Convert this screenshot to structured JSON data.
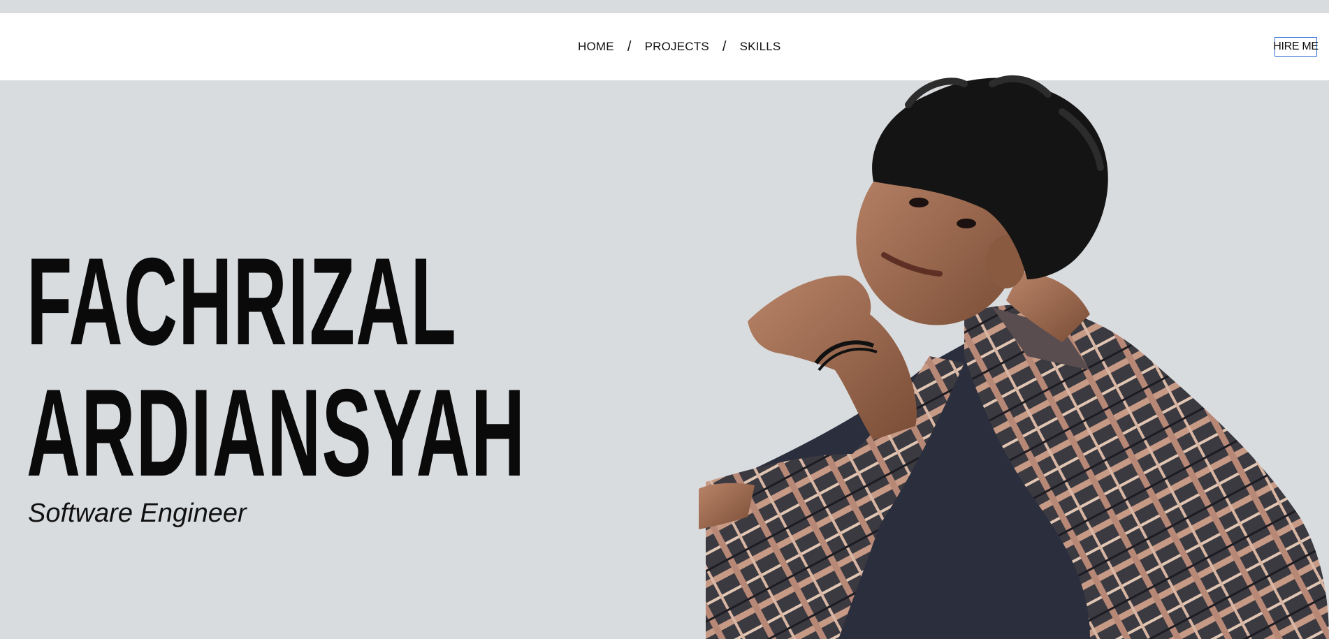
{
  "nav": {
    "links": [
      {
        "label": "HOME"
      },
      {
        "label": "PROJECTS"
      },
      {
        "label": "SKILLS"
      }
    ],
    "separator": "/",
    "hire_button": "HIRE ME"
  },
  "hero": {
    "first_name": "FACHRIZAL",
    "last_name": "ARDIANSYAH",
    "title": "Software Engineer"
  },
  "colors": {
    "page_background": "#d9dcdf",
    "navbar_background": "#ffffff",
    "text": "#0a0a0a",
    "button_border": "#2f6fd6"
  }
}
